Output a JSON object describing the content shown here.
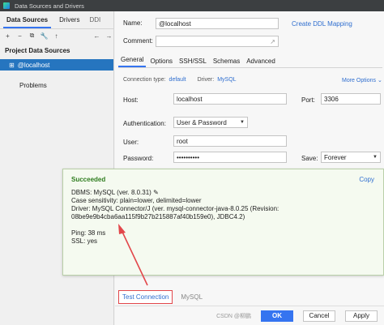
{
  "window": {
    "title": "Data Sources and Drivers"
  },
  "left": {
    "tabs": [
      "Data Sources",
      "Drivers",
      "DDI"
    ],
    "tools": {
      "add": "+",
      "remove": "−",
      "copy": "⧉",
      "settings": "🔧",
      "up": "↑"
    },
    "nav": {
      "back": "←",
      "forward": "→"
    },
    "section_title": "Project Data Sources",
    "selected_item": "@localhost",
    "problems": "Problems"
  },
  "right": {
    "name_label": "Name:",
    "name_value": "@localhost",
    "create_ddl": "Create DDL Mapping",
    "comment_label": "Comment:",
    "subtabs": [
      "General",
      "Options",
      "SSH/SSL",
      "Schemas",
      "Advanced"
    ],
    "connection_type_label": "Connection type:",
    "connection_type_value": "default",
    "driver_label": "Driver:",
    "driver_value": "MySQL",
    "more_options": "More Options",
    "host_label": "Host:",
    "host_value": "localhost",
    "port_label": "Port:",
    "port_value": "3306",
    "auth_label": "Authentication:",
    "auth_value": "User & Password",
    "user_label": "User:",
    "user_value": "root",
    "password_label": "Password:",
    "password_value": "••••••••••",
    "save_label": "Save:",
    "save_value": "Forever"
  },
  "popup": {
    "status": "Succeeded",
    "copy": "Copy",
    "lines": [
      "DBMS: MySQL (ver. 8.0.31)",
      "Case sensitivity: plain=lower, delimited=lower",
      "Driver: MySQL Connector/J (ver. mysql-connector-java-8.0.25 (Revision:",
      "08be9e9b4cba6aa115f9b27b215887af40b159e0), JDBC4.2)",
      "Ping: 38 ms",
      "SSL: yes"
    ]
  },
  "bottom": {
    "test_connection": "Test Connection",
    "mysql_tab": "MySQL"
  },
  "footer": {
    "ok": "OK",
    "cancel": "Cancel",
    "apply": "Apply",
    "watermark": "CSDN @柳鹏"
  },
  "colors": {
    "accent": "#3574f0",
    "success": "#2f7d1f",
    "annotation": "#e2474b"
  }
}
